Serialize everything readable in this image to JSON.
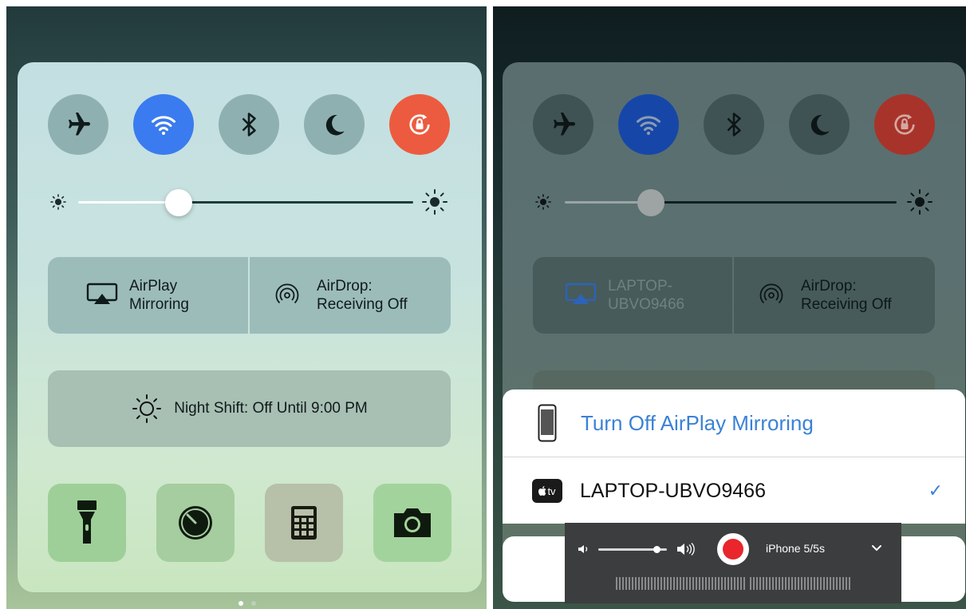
{
  "left": {
    "airplay_line1": "AirPlay",
    "airplay_line2": "Mirroring",
    "airdrop_line1": "AirDrop:",
    "airdrop_line2": "Receiving Off",
    "night_shift": "Night Shift: Off Until 9:00 PM",
    "brightness": 0.3
  },
  "right": {
    "airplay_line1": "LAPTOP-",
    "airplay_line2": "UBVO9466",
    "airdrop_line1": "AirDrop:",
    "airdrop_line2": "Receiving Off",
    "brightness": 0.26
  },
  "sheet": {
    "turn_off": "Turn Off AirPlay Mirroring",
    "appletv_badge": "tv",
    "device_name": "LAPTOP-UBVO9466",
    "checkmark": "✓"
  },
  "recorder": {
    "device": "iPhone 5/5s",
    "volume": 0.85
  },
  "colors": {
    "accent_blue": "#3b7bf0",
    "rotation_lock": "#ec5b3f",
    "record_red": "#e8262c",
    "link_blue": "#3a82d6"
  }
}
